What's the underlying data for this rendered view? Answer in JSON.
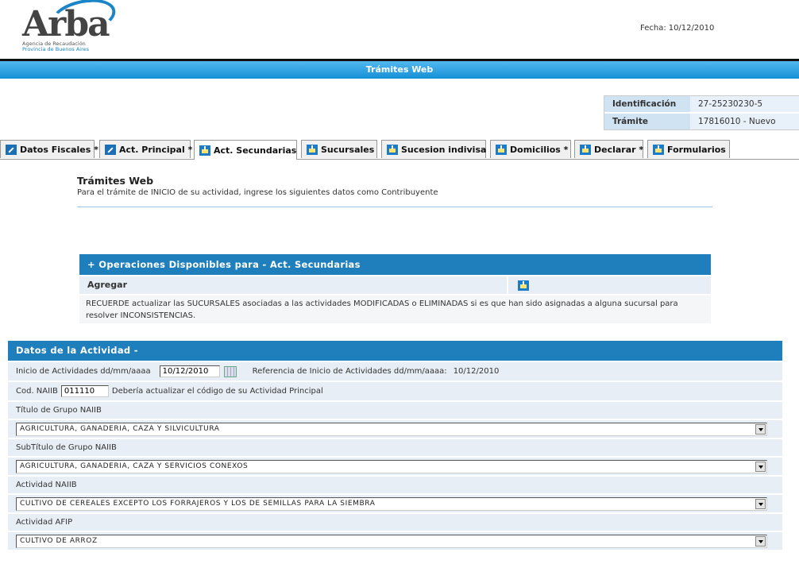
{
  "logo": {
    "name": "Arba",
    "line1": "Agencia de Recaudación",
    "line2": "Provincia de Buenos Aires"
  },
  "header": {
    "fecha_label": "Fecha:",
    "fecha_value": "10/12/2010",
    "banner": "Trámites Web"
  },
  "id_box": {
    "rows": [
      {
        "label": "Identificación",
        "value": "27-25230230-5"
      },
      {
        "label": "Trámite",
        "value": "17816010 - Nuevo"
      }
    ]
  },
  "tabs": [
    {
      "label": "Datos Fiscales *",
      "icon": "pencil-icon"
    },
    {
      "label": "Act. Principal *",
      "icon": "pencil-icon"
    },
    {
      "label": "Act. Secundarias",
      "icon": "tray-icon",
      "active": true
    },
    {
      "label": "Sucursales",
      "icon": "tray-icon"
    },
    {
      "label": "Sucesion indivisa",
      "icon": "tray-icon"
    },
    {
      "label": "Domicilios *",
      "icon": "tray-icon"
    },
    {
      "label": "Declarar *",
      "icon": "tray-icon"
    },
    {
      "label": "Formularios",
      "icon": "tray-icon"
    }
  ],
  "intro": {
    "title": "Trámites Web",
    "subtitle": "Para el trámite de INICIO de su actividad, ingrese los siguientes datos como Contribuyente"
  },
  "operaciones": {
    "header": "+ Operaciones Disponibles para - Act. Secundarias",
    "agregar_label": "Agregar",
    "note": "RECUERDE actualizar las SUCURSALES asociadas a las actividades MODIFICADAS o ELIMINADAS si es que han sido asignadas a alguna sucursal para resolver INCONSISTENCIAS."
  },
  "datos_actividad": {
    "header": "Datos de la Actividad  -",
    "inicio_label": "Inicio de Actividades dd/mm/aaaa",
    "inicio_value": "10/12/2010",
    "referencia_label": "Referencia de Inicio de Actividades dd/mm/aaaa:",
    "referencia_value": "10/12/2010",
    "naiib_label": "Cod. NAIIB",
    "naiib_value": "011110",
    "naiib_note": "Debería actualizar el código de su Actividad Principal",
    "titulo_grupo_label": "Título de Grupo NAIIB",
    "titulo_grupo_value": "AGRICULTURA, GANADERIA, CAZA Y SILVICULTURA",
    "subtitulo_grupo_label": "SubTítulo de Grupo NAIIB",
    "subtitulo_grupo_value": "AGRICULTURA, GANADERIA, CAZA Y SERVICIOS CONEXOS",
    "actividad_naiib_label": "Actividad NAIIB",
    "actividad_naiib_value": "CULTIVO DE CEREALES EXCEPTO LOS FORRAJEROS Y LOS DE SEMILLAS PARA LA SIEMBRA",
    "actividad_afip_label": "Actividad AFIP",
    "actividad_afip_value": "CULTIVO DE ARROZ"
  }
}
